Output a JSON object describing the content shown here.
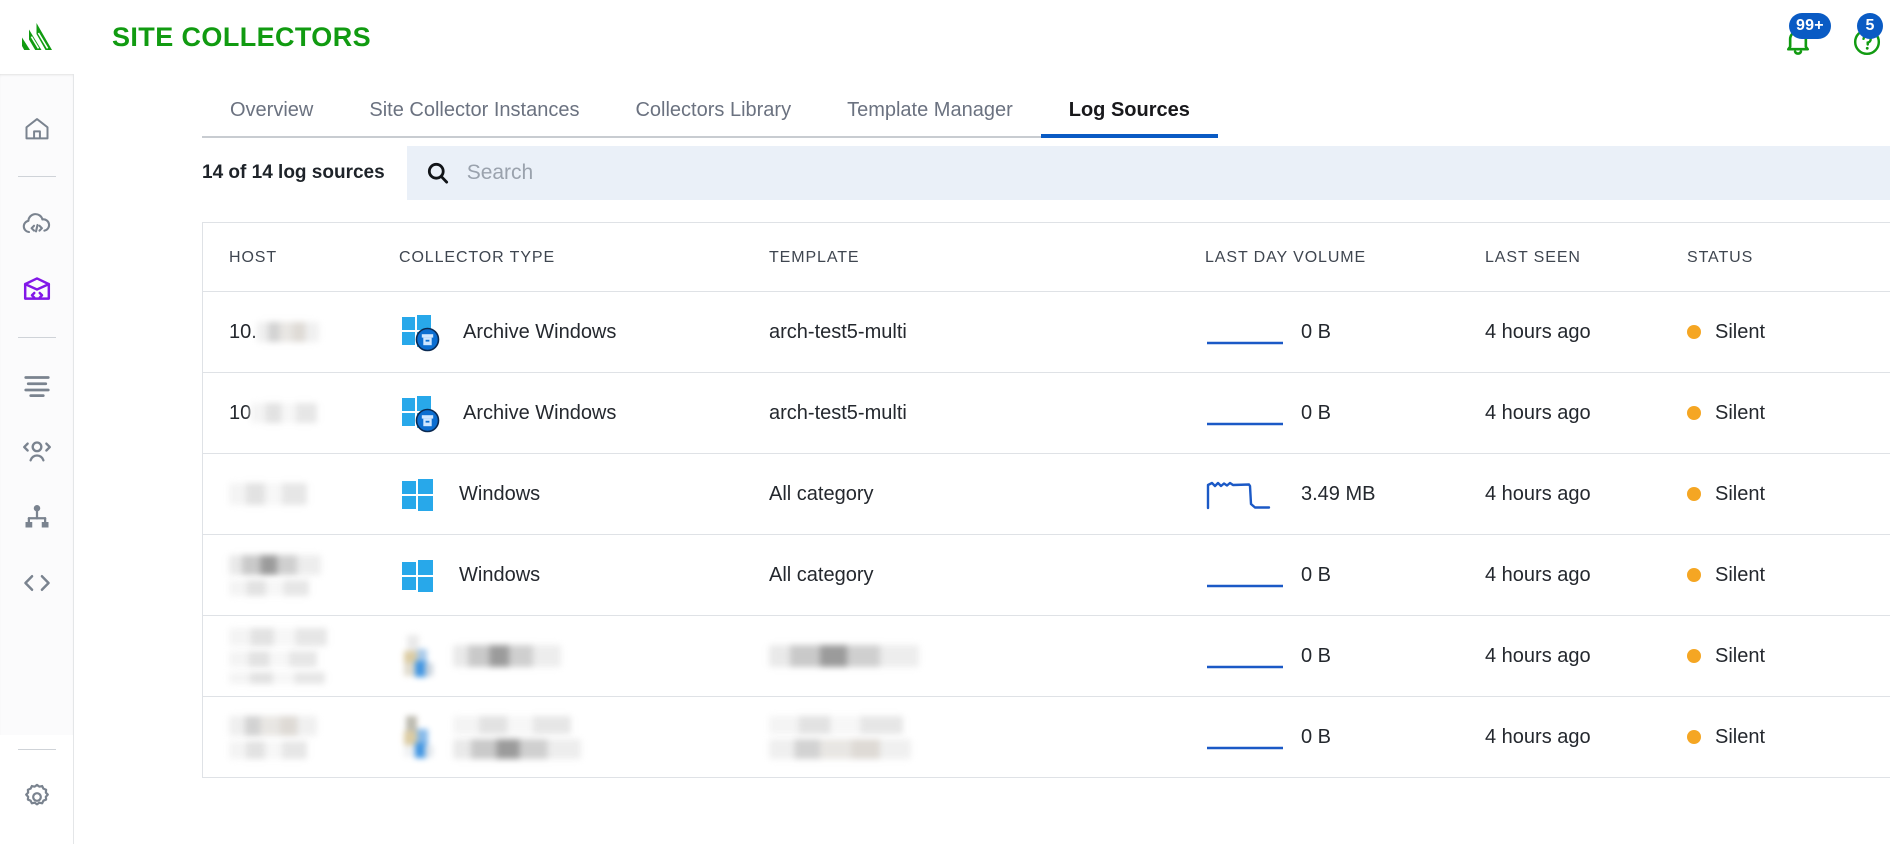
{
  "brand": {
    "logo_icon": "sumo-logo-icon",
    "accent_green": "#119b11",
    "accent_blue": "#0a5bc4"
  },
  "header": {
    "title": "SITE COLLECTORS",
    "notifications": {
      "icon": "bell-icon",
      "badge": "99+"
    },
    "help": {
      "icon": "question-circle-icon",
      "badge": "5"
    },
    "avatar_icon": "avatar-icon"
  },
  "sidebar": {
    "items": [
      {
        "icon": "home-icon",
        "active": false
      },
      {
        "icon": "cloud-code-icon",
        "active": false
      },
      {
        "icon": "cube-code-icon",
        "active": true
      },
      {
        "icon": "list-lines-icon",
        "active": false
      },
      {
        "icon": "users-icon",
        "active": false
      },
      {
        "icon": "hierarchy-icon",
        "active": false
      },
      {
        "icon": "code-brackets-icon",
        "active": false
      },
      {
        "icon": "gear-icon",
        "active": false
      }
    ]
  },
  "tabs": [
    {
      "label": "Overview",
      "active": false
    },
    {
      "label": "Site Collector Instances",
      "active": false
    },
    {
      "label": "Collectors Library",
      "active": false
    },
    {
      "label": "Template Manager",
      "active": false
    },
    {
      "label": "Log Sources",
      "active": true
    }
  ],
  "toolbar": {
    "count_label": "14 of 14 log sources",
    "search_placeholder": "Search",
    "search_value": "",
    "search_icon": "search-icon"
  },
  "table": {
    "columns": [
      "HOST",
      "COLLECTOR TYPE",
      "TEMPLATE",
      "LAST DAY VOLUME",
      "LAST SEEN",
      "STATUS"
    ],
    "rows": [
      {
        "host": "10.",
        "host_redacted": true,
        "collector_type": "Archive Windows",
        "collector_icon": "windows-archive-icon",
        "template": "arch-test5-multi",
        "volume": "0 B",
        "sparkline": "flat",
        "last_seen": "4 hours ago",
        "status": "Silent",
        "status_color": "#f5a623"
      },
      {
        "host": "10",
        "host_redacted": true,
        "collector_type": "Archive Windows",
        "collector_icon": "windows-archive-icon",
        "template": "arch-test5-multi",
        "volume": "0 B",
        "sparkline": "flat",
        "last_seen": "4 hours ago",
        "status": "Silent",
        "status_color": "#f5a623"
      },
      {
        "host": "",
        "host_redacted": true,
        "collector_type": "Windows",
        "collector_icon": "windows-icon",
        "template": "All category",
        "volume": "3.49 MB",
        "sparkline": "plateau",
        "last_seen": "4 hours ago",
        "status": "Silent",
        "status_color": "#f5a623"
      },
      {
        "host": "",
        "host_redacted": true,
        "collector_type": "Windows",
        "collector_icon": "windows-icon",
        "template": "All category",
        "volume": "0 B",
        "sparkline": "flat",
        "last_seen": "4 hours ago",
        "status": "Silent",
        "status_color": "#f5a623"
      },
      {
        "host": "",
        "host_redacted": true,
        "collector_type": "",
        "collector_icon": "windows-icon",
        "type_redacted": true,
        "template": "",
        "template_redacted": true,
        "volume": "0 B",
        "sparkline": "flat",
        "last_seen": "4 hours ago",
        "status": "Silent",
        "status_color": "#f5a623"
      },
      {
        "host": "",
        "host_redacted": true,
        "collector_type": "",
        "collector_icon": "windows-icon",
        "type_redacted": true,
        "template": "",
        "template_redacted": true,
        "volume": "0 B",
        "sparkline": "flat",
        "last_seen": "4 hours ago",
        "status": "Silent",
        "status_color": "#f5a623"
      }
    ]
  }
}
